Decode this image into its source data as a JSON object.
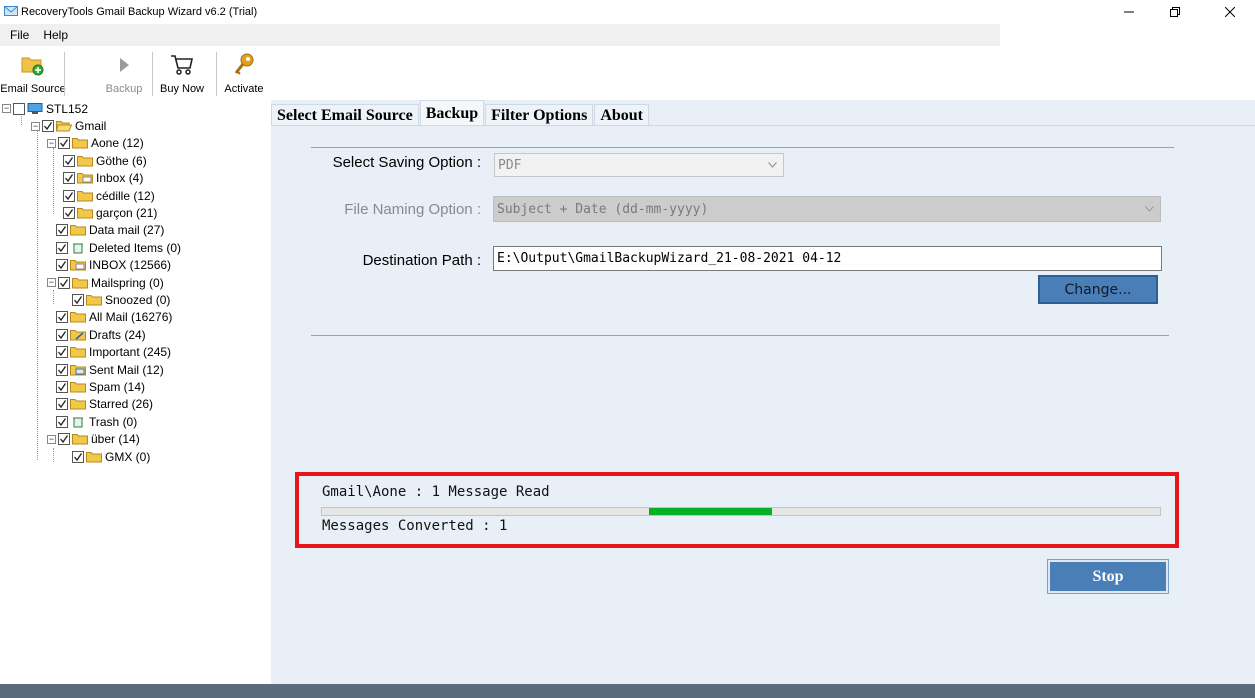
{
  "window": {
    "title": "RecoveryTools Gmail Backup Wizard v6.2 (Trial)",
    "icons": [
      "app-mail-icon",
      "minimize-icon",
      "restore-icon",
      "close-icon"
    ]
  },
  "menu": {
    "file": "File",
    "help": "Help"
  },
  "toolbar": {
    "email_source": "Email Source",
    "backup": "Backup",
    "buy_now": "Buy Now",
    "activate": "Activate"
  },
  "tree": {
    "root": "STL152",
    "gmail": "Gmail",
    "aone": "Aone (12)",
    "gothe": "Göthe (6)",
    "inbox_sub": "Inbox (4)",
    "cedille": "cédille (12)",
    "garcon": "garçon (21)",
    "data_mail": "Data mail (27)",
    "deleted": "Deleted Items (0)",
    "inbox": "INBOX (12566)",
    "mailspring": "Mailspring (0)",
    "snoozed": "Snoozed (0)",
    "all_mail": "All Mail (16276)",
    "drafts": "Drafts (24)",
    "important": "Important (245)",
    "sent": "Sent Mail (12)",
    "spam": "Spam (14)",
    "starred": "Starred (26)",
    "trash": "Trash (0)",
    "uber": "über (14)",
    "gmx": "GMX (0)"
  },
  "tabs": {
    "select_source": "Select Email Source",
    "backup": "Backup",
    "filter": "Filter Options",
    "about": "About",
    "active": "Backup"
  },
  "form": {
    "saving_label": "Select Saving Option :",
    "saving_value": "PDF",
    "naming_label": "File Naming Option :",
    "naming_value": "Subject + Date (dd-mm-yyyy)",
    "dest_label": "Destination Path :",
    "dest_value": "E:\\Output\\GmailBackupWizard_21-08-2021 04-12",
    "change_button": "Change..."
  },
  "progress": {
    "status": "Gmail\\Aone : 1 Message Read",
    "converted": "Messages Converted : 1",
    "bar_start_fraction": 0.39,
    "bar_fill_fraction": 0.147,
    "fill_color": "#06b025"
  },
  "stop_button": "Stop",
  "colors": {
    "highlight_border": "#e8141c",
    "button_blue": "#4a7eb6",
    "panel_bg": "#e8eff7"
  }
}
